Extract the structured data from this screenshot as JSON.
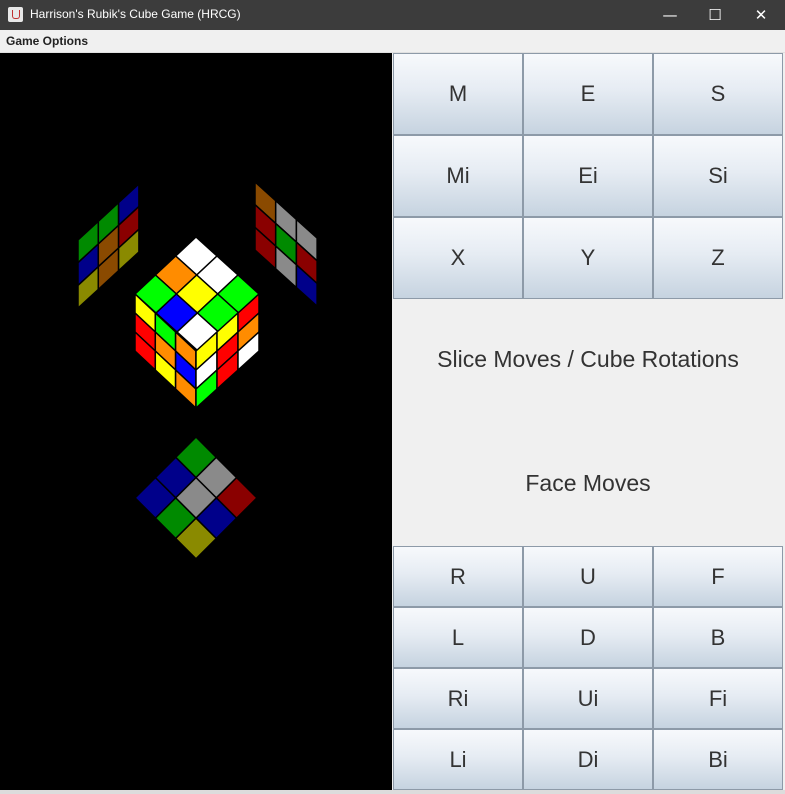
{
  "window": {
    "title": "Harrison's Rubik's Cube Game (HRCG)",
    "minimize_symbol": "—",
    "maximize_symbol": "☐",
    "close_symbol": "✕",
    "icon": "java-cup-icon"
  },
  "menu": {
    "items": [
      "Game Options"
    ]
  },
  "slice_buttons": [
    "M",
    "E",
    "S",
    "Mi",
    "Ei",
    "Si",
    "X",
    "Y",
    "Z"
  ],
  "labels": {
    "slice": "Slice Moves / Cube Rotations",
    "face": "Face Moves"
  },
  "face_buttons": [
    "R",
    "U",
    "F",
    "L",
    "D",
    "B",
    "Ri",
    "Ui",
    "Fi",
    "Li",
    "Di",
    "Bi"
  ],
  "colors": {
    "white": "#ffffff",
    "yellow": "#ffff00",
    "green": "#00ff00",
    "blue": "#0000ff",
    "red": "#ff0000",
    "orange": "#ff8c00",
    "dim_white": "#8a8a8a",
    "dim_yellow": "#8a8a00",
    "dim_green": "#008a00",
    "dim_blue": "#00008a",
    "dim_red": "#8a0000",
    "dim_orange": "#8a4a00",
    "background": "#000000"
  },
  "cube": {
    "top_face": [
      [
        "white",
        "white",
        "green"
      ],
      [
        "orange",
        "yellow",
        "green"
      ],
      [
        "green",
        "blue",
        "white"
      ]
    ],
    "left_face": [
      [
        "yellow",
        "green",
        "orange"
      ],
      [
        "red",
        "orange",
        "blue"
      ],
      [
        "red",
        "yellow",
        "orange"
      ]
    ],
    "right_face": [
      [
        "yellow",
        "yellow",
        "red"
      ],
      [
        "white",
        "red",
        "orange"
      ],
      [
        "green",
        "red",
        "white"
      ]
    ],
    "back_left_reflection": [
      [
        "dim_green",
        "dim_green",
        "dim_blue"
      ],
      [
        "dim_blue",
        "dim_orange",
        "dim_red"
      ],
      [
        "dim_yellow",
        "dim_orange",
        "dim_yellow"
      ]
    ],
    "back_right_reflection": [
      [
        "dim_orange",
        "dim_white",
        "dim_white"
      ],
      [
        "dim_red",
        "dim_green",
        "dim_red"
      ],
      [
        "dim_red",
        "dim_white",
        "dim_blue"
      ]
    ],
    "bottom_reflection": [
      [
        "dim_green",
        "dim_white",
        "dim_red"
      ],
      [
        "dim_blue",
        "dim_white",
        "dim_blue"
      ],
      [
        "dim_blue",
        "dim_green",
        "dim_yellow"
      ]
    ]
  }
}
